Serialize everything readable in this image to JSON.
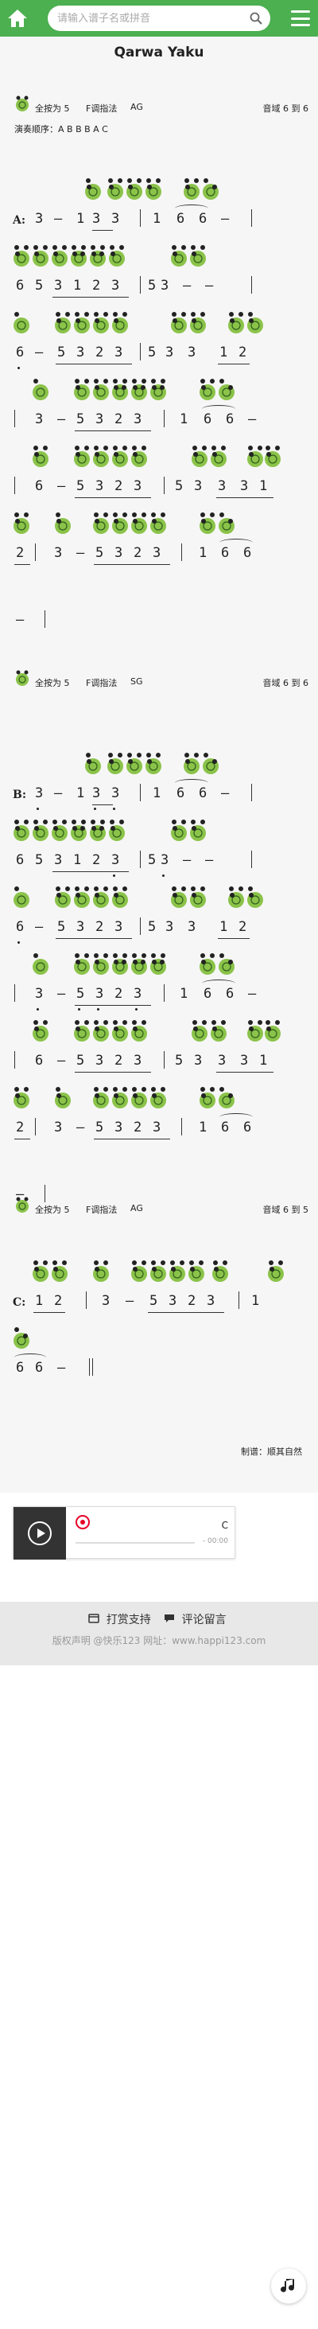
{
  "header": {
    "search_placeholder": "请输入谱子名或拼音"
  },
  "song": {
    "title": "Qarwa Yaku"
  },
  "blocks": [
    {
      "key": "全按为 5",
      "fingering": "F调指法",
      "fingering_name": "AG",
      "range": "音域  6 到 6",
      "order": "演奏顺序：A B B B A C",
      "section": "A:"
    },
    {
      "key": "全按为 5",
      "fingering": "F调指法",
      "fingering_name": "SG",
      "range": "音域  6 到 6",
      "section": "B:"
    },
    {
      "key": "全按为 5",
      "fingering": "F调指法",
      "fingering_name": "AG",
      "range": "音域  6 到 5",
      "section": "C:"
    }
  ],
  "credit": "制谱：顺其自然",
  "player": {
    "song_letter": "C",
    "time": "- 00:00"
  },
  "footer": {
    "donate": "打赏支持",
    "comment": "评论留言",
    "copyright": "版权声明  @快乐123 网址：www.happi123.com"
  },
  "colors": {
    "brand": "#4caf50",
    "hole_green": "#8bc34a",
    "sheet_bg": "#f6f6f6"
  },
  "icons": [
    "home-icon",
    "search-icon",
    "menu-icon",
    "play-icon",
    "netease-icon",
    "wallet-icon",
    "chat-icon",
    "music-note-icon"
  ]
}
